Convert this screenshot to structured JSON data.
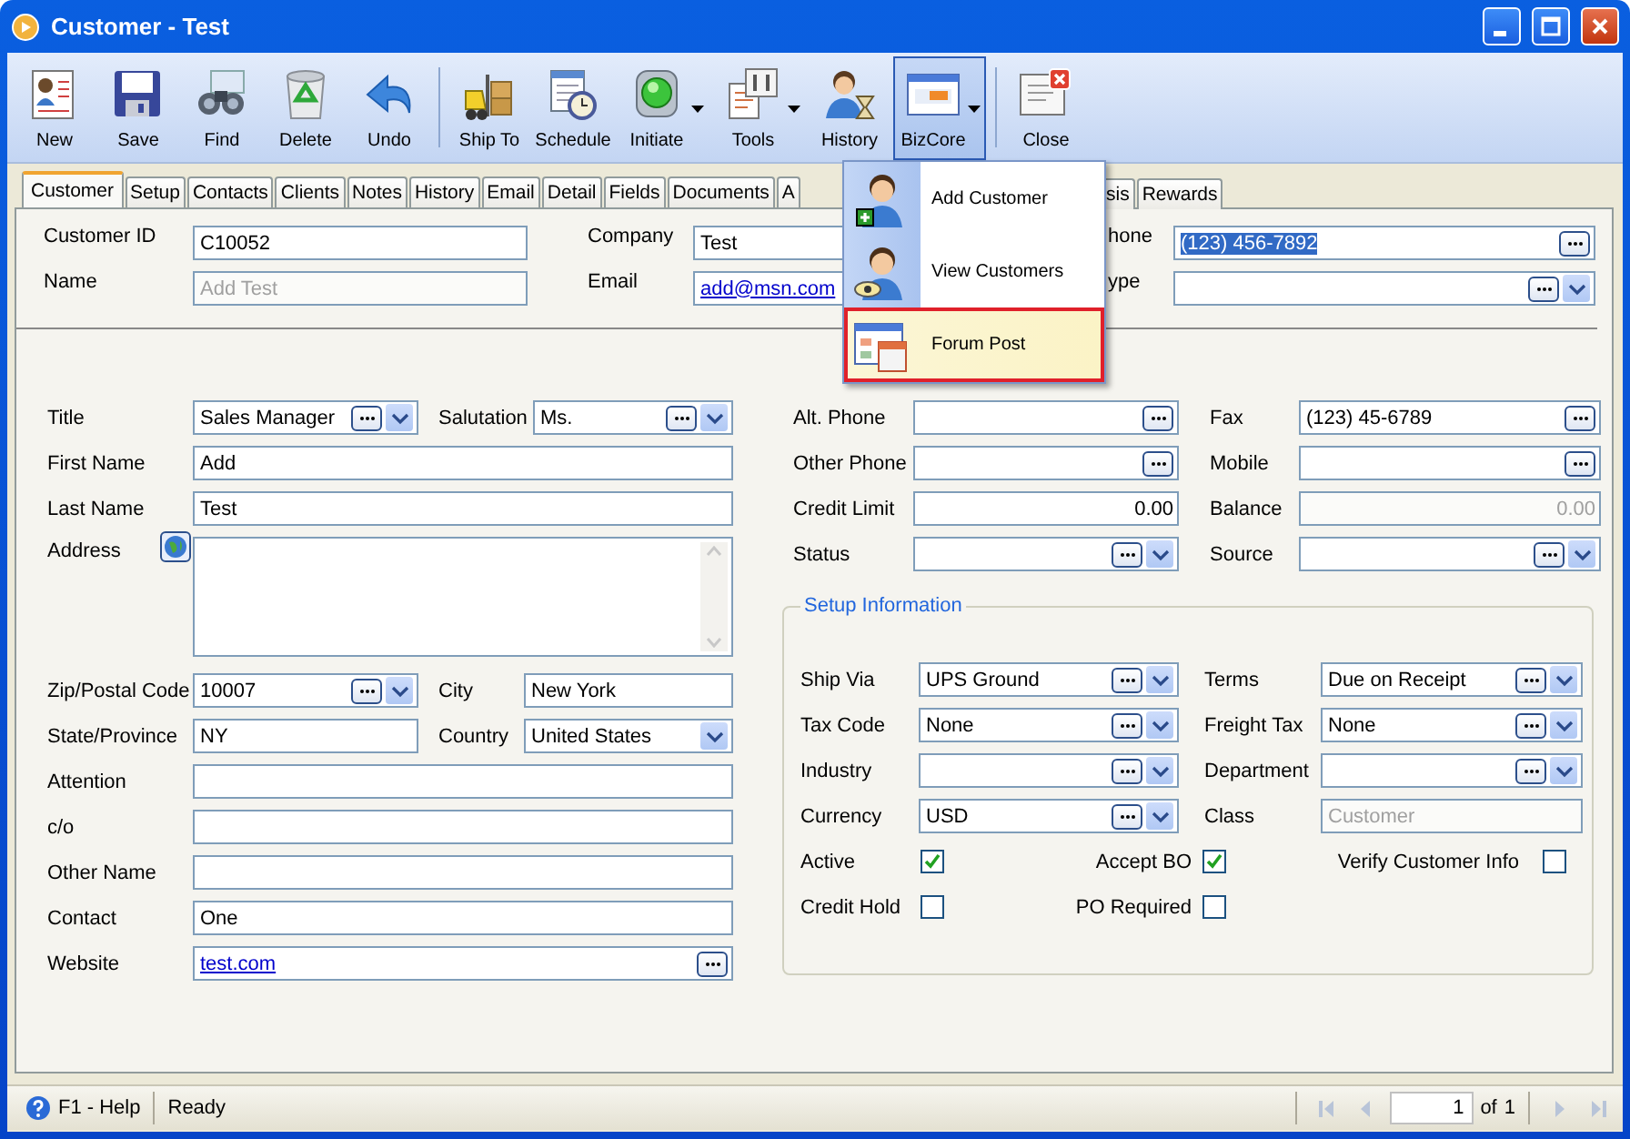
{
  "window": {
    "title": "Customer - Test"
  },
  "toolbar": [
    {
      "label": "New"
    },
    {
      "label": "Save"
    },
    {
      "label": "Find"
    },
    {
      "label": "Delete"
    },
    {
      "label": "Undo"
    },
    {
      "label": "Ship To",
      "separator_before": true
    },
    {
      "label": "Schedule"
    },
    {
      "label": "Initiate",
      "has_menu": true
    },
    {
      "label": "Tools",
      "has_menu": true
    },
    {
      "label": "History"
    },
    {
      "label": "BizCore",
      "has_menu": true,
      "pressed": true
    },
    {
      "label": "Close",
      "separator_before": true
    }
  ],
  "menu": {
    "items": [
      {
        "label": "Add Customer",
        "selected": false
      },
      {
        "label": "View Customers",
        "selected": false
      },
      {
        "label": "Forum Post",
        "selected": true
      }
    ]
  },
  "tabs": [
    {
      "label": "Customer",
      "selected": true
    },
    {
      "label": "Setup",
      "selected": false
    },
    {
      "label": "Contacts",
      "selected": false
    },
    {
      "label": "Clients",
      "selected": false
    },
    {
      "label": "Notes",
      "selected": false
    },
    {
      "label": "History",
      "selected": false
    },
    {
      "label": "Email",
      "selected": false
    },
    {
      "label": "Detail",
      "selected": false
    },
    {
      "label": "Fields",
      "selected": false
    },
    {
      "label": "Documents",
      "selected": false
    },
    {
      "label": "A",
      "selected": false
    }
  ],
  "tabs_right": [
    {
      "label": "sis",
      "selected": false
    },
    {
      "label": "Rewards",
      "selected": false
    }
  ],
  "header": {
    "rows": [
      [
        {
          "label": "Customer ID",
          "value": "C10052"
        },
        {
          "label": "Company",
          "value": "Test"
        },
        {
          "label": "hone",
          "value": "(123) 456-7892",
          "lookup": true,
          "highlighted": true
        }
      ],
      [
        {
          "label": "Name",
          "value": "Add Test",
          "disabled": true
        },
        {
          "label": "Email",
          "value": "add@msn.com",
          "link": true
        },
        {
          "label": "ype",
          "lookup": true,
          "dropdown": true
        }
      ]
    ]
  },
  "left": [
    [
      {
        "label": "Title",
        "value": "Sales Manager",
        "lookup": true,
        "dropdown": true
      },
      {
        "label": "Salutation",
        "value": "Ms.",
        "lookup": true,
        "dropdown": true
      }
    ],
    [
      {
        "label": "First Name",
        "value": "Add"
      }
    ],
    [
      {
        "label": "Last Name",
        "value": "Test"
      }
    ],
    [
      {
        "label": "Address",
        "multiline": true,
        "globe": true
      }
    ],
    [
      {
        "label": "Zip/Postal Code",
        "value": "10007",
        "lookup": true,
        "dropdown": true
      },
      {
        "label": "City",
        "value": "New York"
      }
    ],
    [
      {
        "label": "State/Province",
        "value": "NY"
      },
      {
        "label": "Country",
        "value": "United States",
        "dropdown": true
      }
    ],
    [
      {
        "label": "Attention"
      }
    ],
    [
      {
        "label": "c/o"
      }
    ],
    [
      {
        "label": "Other Name"
      }
    ],
    [
      {
        "label": "Contact",
        "value": "One"
      }
    ],
    [
      {
        "label": "Website",
        "value": "test.com",
        "link": true,
        "lookup": true
      }
    ]
  ],
  "right": [
    [
      {
        "label": "Alt. Phone",
        "lookup": true
      },
      {
        "label": "Fax",
        "value": "(123) 45-6789",
        "lookup": true
      }
    ],
    [
      {
        "label": "Other Phone",
        "lookup": true
      },
      {
        "label": "Mobile",
        "lookup": true
      }
    ],
    [
      {
        "label": "Credit Limit",
        "value": "0.00",
        "numeric": true
      },
      {
        "label": "Balance",
        "value": "0.00",
        "numeric": true,
        "disabled": true
      }
    ],
    [
      {
        "label": "Status",
        "lookup": true,
        "dropdown": true
      },
      {
        "label": "Source",
        "lookup": true,
        "dropdown": true
      }
    ]
  ],
  "setup": {
    "title": "Setup Information",
    "rows": [
      [
        {
          "label": "Ship Via",
          "value": "UPS Ground",
          "lookup": true,
          "dropdown": true
        },
        {
          "label": "Terms",
          "value": "Due on Receipt",
          "lookup": true,
          "dropdown": true
        }
      ],
      [
        {
          "label": "Tax Code",
          "value": "None",
          "lookup": true,
          "dropdown": true
        },
        {
          "label": "Freight Tax",
          "value": "None",
          "lookup": true,
          "dropdown": true
        }
      ],
      [
        {
          "label": "Industry",
          "lookup": true,
          "dropdown": true
        },
        {
          "label": "Department",
          "lookup": true,
          "dropdown": true
        }
      ],
      [
        {
          "label": "Currency",
          "value": "USD",
          "lookup": true,
          "dropdown": true
        },
        {
          "label": "Class",
          "value": "Customer",
          "disabled": true
        }
      ]
    ],
    "checks": [
      {
        "label": "Active",
        "checked": true
      },
      {
        "label": "Accept BO",
        "checked": true
      },
      {
        "label": "Verify Customer Info",
        "checked": false
      },
      {
        "label": "Credit Hold",
        "checked": false
      },
      {
        "label": "PO Required",
        "checked": false
      }
    ]
  },
  "status_bar": {
    "help": "F1 - Help",
    "status": "Ready",
    "page": "1",
    "of": "of",
    "total": "1"
  }
}
